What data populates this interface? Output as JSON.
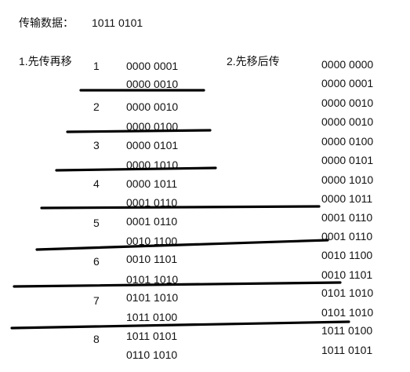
{
  "header": {
    "label": "传输数据：",
    "value": "1011 0101"
  },
  "method1": {
    "title": "1.先传再移",
    "steps": [
      {
        "num": "1",
        "before": "0000 0001",
        "after": "0000 0010"
      },
      {
        "num": "2",
        "before": "0000 0010",
        "after": "0000 0100"
      },
      {
        "num": "3",
        "before": "0000 0101",
        "after": "0000 1010"
      },
      {
        "num": "4",
        "before": "0000 1011",
        "after": "0001 0110"
      },
      {
        "num": "5",
        "before": "0001 0110",
        "after": "0010 1100"
      },
      {
        "num": "6",
        "before": "0010 1101",
        "after": "0101 1010"
      },
      {
        "num": "7",
        "before": "0101 1010",
        "after": "1011 0100"
      },
      {
        "num": "8",
        "before": "1011 0101",
        "after": "0110 1010"
      }
    ]
  },
  "method2": {
    "title": "2.先移后传",
    "values": [
      "0000 0000",
      "0000 0001",
      "0000 0010",
      "0000 0010",
      "0000 0100",
      "0000 0101",
      "0000 1010",
      "0000 1011",
      "0001 0110",
      "0001 0110",
      "0010 1100",
      "0010 1101",
      "0101 1010",
      "0101 1010",
      "1011 0100",
      "1011 0101"
    ]
  },
  "stroke_color": "#000000"
}
